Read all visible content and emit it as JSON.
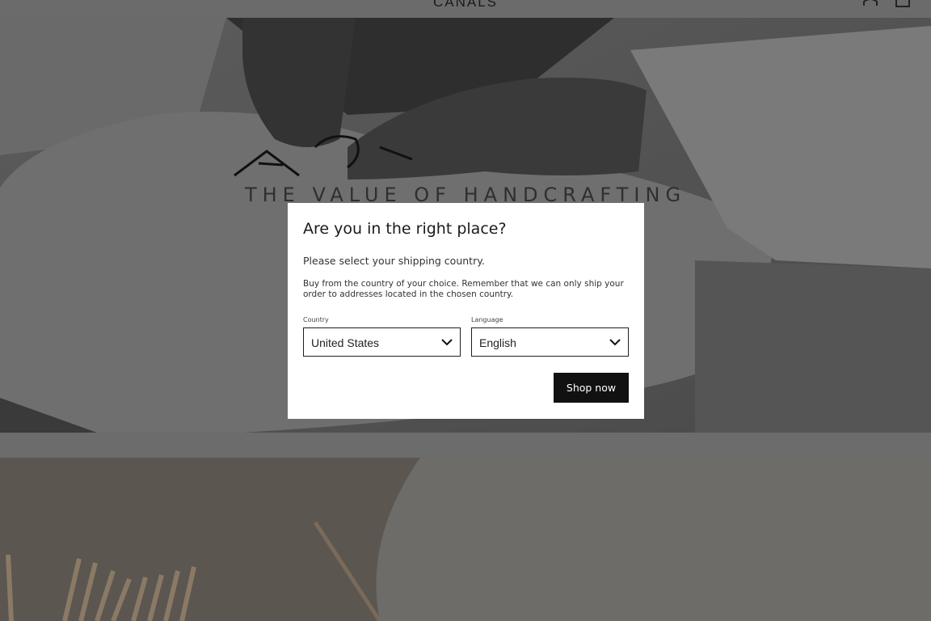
{
  "header": {
    "logo": "CANALS",
    "icons": [
      "menu-icon",
      "search-icon",
      "account-icon",
      "cart-icon"
    ]
  },
  "hero": {
    "heading": "THE VALUE OF HANDCRAFTING"
  },
  "modal": {
    "title": "Are you in the right place?",
    "subtitle": "Please select your shipping country.",
    "description": "Buy from the country of your choice. Remember that we can only ship your order to addresses located in the chosen country.",
    "country": {
      "label": "Country",
      "value": "United States"
    },
    "language": {
      "label": "Language",
      "value": "English"
    },
    "submit_label": "Shop now"
  }
}
